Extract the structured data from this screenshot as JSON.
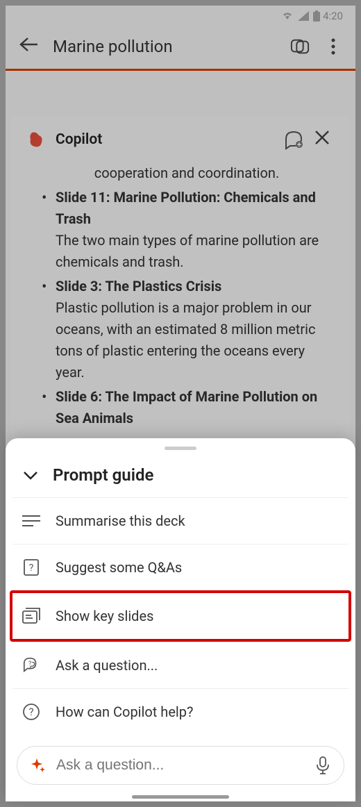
{
  "status": {
    "time": "4:20"
  },
  "header": {
    "title": "Marine pollution"
  },
  "copilot": {
    "title": "Copilot",
    "intro": "cooperation and coordination.",
    "slides": [
      {
        "title": "Slide 11: Marine Pollution: Chemicals and Trash",
        "desc": "The two main types of marine pollution are chemicals and trash."
      },
      {
        "title": "Slide 3: The Plastics Crisis",
        "desc": "Plastic pollution is a major problem in our oceans, with an estimated 8 million metric tons of plastic entering the oceans every year."
      },
      {
        "title": "Slide 6: The Impact of Marine Pollution on Sea Animals",
        "desc": ""
      }
    ]
  },
  "promptGuide": {
    "title": "Prompt guide",
    "items": [
      {
        "label": "Summarise this deck"
      },
      {
        "label": "Suggest some Q&As"
      },
      {
        "label": "Show key slides"
      },
      {
        "label": "Ask a question..."
      },
      {
        "label": "How can Copilot help?"
      }
    ]
  },
  "input": {
    "placeholder": "Ask a question..."
  }
}
